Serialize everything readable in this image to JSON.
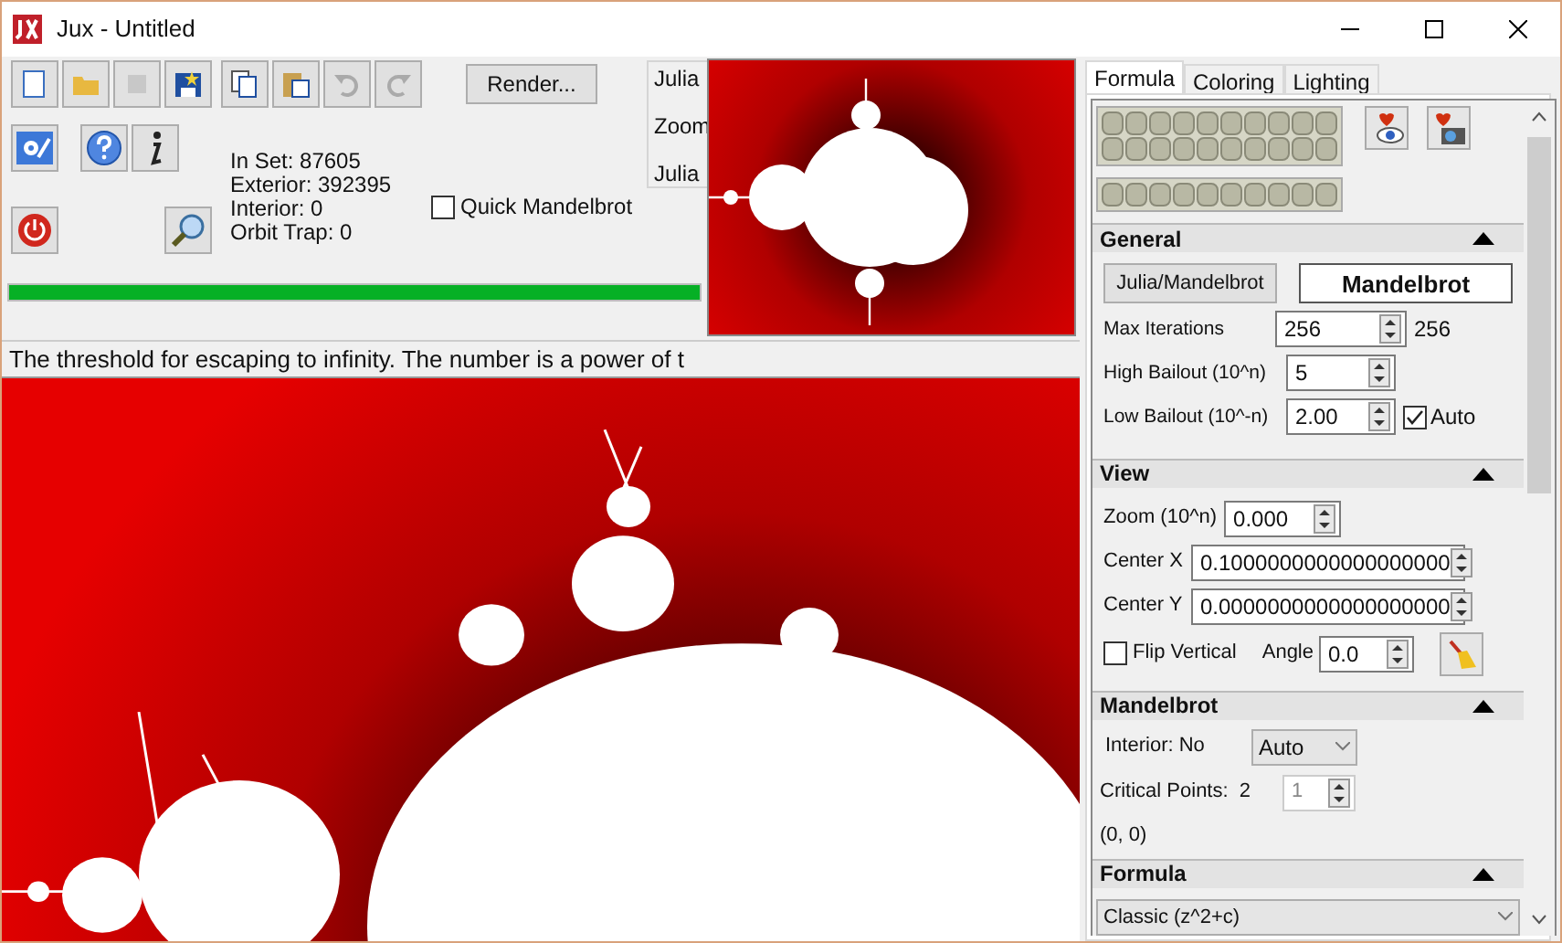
{
  "window": {
    "title": "Jux - Untitled"
  },
  "toolbar": {
    "render_button": "Render..."
  },
  "stats": [
    "In Set: 87605",
    "Exterior: 392395",
    "Interior: 0",
    "Orbit Trap: 0"
  ],
  "quick_mandelbrot": {
    "label": "Quick Mandelbrot",
    "checked": false
  },
  "julia_group": [
    "Julia",
    "Zoom",
    "Julia"
  ],
  "progress": {
    "level": 1
  },
  "status_text": "The threshold for escaping to infinity. The number is a power of t",
  "tabs": [
    {
      "label": "Formula",
      "selected": true
    },
    {
      "label": "Coloring",
      "selected": false
    },
    {
      "label": "Lighting",
      "selected": false
    }
  ],
  "general": {
    "title": "General",
    "mode_button": "Julia/Mandelbrot",
    "mode_value": "Mandelbrot",
    "rows": [
      {
        "label": "Max Iterations",
        "value": "256",
        "reading": "256"
      },
      {
        "label": "High Bailout (10^n)",
        "value": "5"
      },
      {
        "label": "Low Bailout (10^-n)",
        "value": "2.00"
      }
    ],
    "auto": {
      "label": "Auto",
      "checked": true
    }
  },
  "view": {
    "title": "View",
    "zoom": {
      "label": "Zoom (10^n)",
      "value": "0.000"
    },
    "center_x": {
      "label": "Center X",
      "value": "0.1000000000000000000"
    },
    "center_y": {
      "label": "Center Y",
      "value": "0.0000000000000000000"
    },
    "flip": {
      "label": "Flip Vertical",
      "checked": false
    },
    "angle": {
      "label": "Angle",
      "value": "0.0"
    }
  },
  "mandelbrot": {
    "title": "Mandelbrot",
    "interior_label": "Interior: No",
    "interior_value": "Auto",
    "critical_label": "Critical Points:  2",
    "critical_value": "1",
    "point": "(0, 0)"
  },
  "formula": {
    "title": "Formula",
    "value": "Classic (z^2+c)"
  }
}
